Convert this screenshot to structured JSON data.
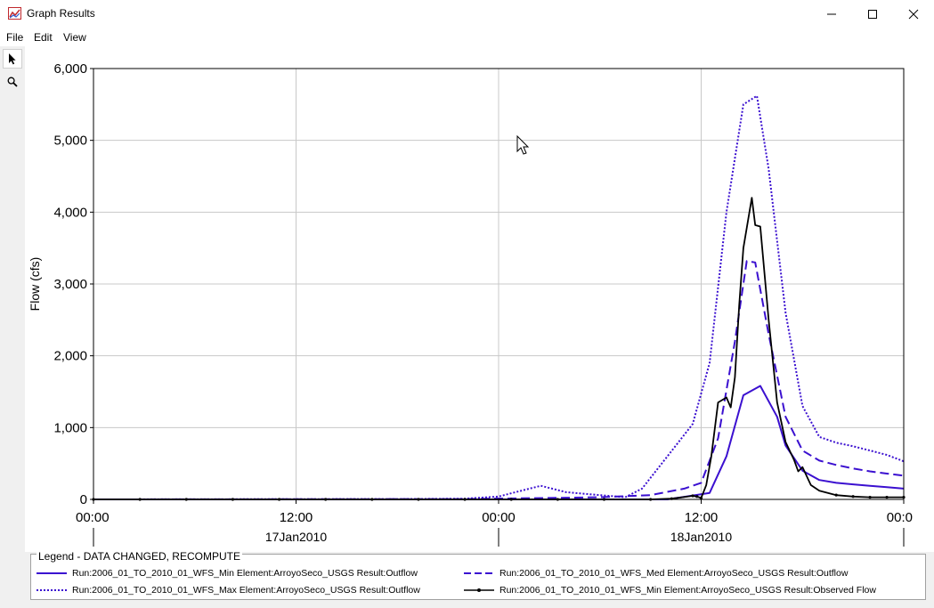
{
  "window": {
    "title": "Graph Results"
  },
  "menu": [
    "File",
    "Edit",
    "View"
  ],
  "icons": {
    "app": "graph-app-icon",
    "pointer": "pointer-arrow-icon",
    "zoom": "magnifier-icon",
    "cursor": "mouse-cursor-icon"
  },
  "legend": {
    "title": "Legend - DATA CHANGED, RECOMPUTE",
    "entries": [
      {
        "label": "Run:2006_01_TO_2010_01_WFS_Min Element:ArroyoSeco_USGS Result:Outflow",
        "color": "#3b10d0",
        "style": "solid"
      },
      {
        "label": "Run:2006_01_TO_2010_01_WFS_Med Element:ArroyoSeco_USGS Result:Outflow",
        "color": "#3b10d0",
        "style": "dashed"
      },
      {
        "label": "Run:2006_01_TO_2010_01_WFS_Max Element:ArroyoSeco_USGS Result:Outflow",
        "color": "#3b10d0",
        "style": "dotted"
      },
      {
        "label": "Run:2006_01_TO_2010_01_WFS_Min Element:ArroyoSeco_USGS Result:Observed Flow",
        "color": "#000000",
        "style": "solid-marker"
      }
    ]
  },
  "chart_data": {
    "type": "line",
    "ylabel": "Flow (cfs)",
    "ylim": [
      0,
      6000
    ],
    "yticks": [
      0,
      1000,
      2000,
      3000,
      4000,
      5000,
      6000
    ],
    "ytick_labels": [
      "0",
      "1,000",
      "2,000",
      "3,000",
      "4,000",
      "5,000",
      "6,000"
    ],
    "xlim_hours": [
      0,
      48
    ],
    "xticks_hours": [
      0,
      12,
      24,
      36,
      48
    ],
    "xtick_labels": [
      "00:00",
      "12:00",
      "00:00",
      "12:00",
      "00:0"
    ],
    "date_labels": [
      {
        "label": "17Jan2010",
        "at_hours": 12
      },
      {
        "label": "18Jan2010",
        "at_hours": 36
      }
    ],
    "day_separators_hours": [
      0,
      24,
      48
    ],
    "grid": true,
    "series": [
      {
        "name": "Run:2006_01_TO_2010_01_WFS_Min Element:ArroyoSeco_USGS Result:Outflow",
        "style": "solid",
        "color": "#3b10d0",
        "x": [
          0,
          24,
          34,
          36.5,
          37.5,
          38.5,
          39.5,
          40.5,
          41,
          42,
          43,
          44,
          45,
          46,
          47,
          48
        ],
        "y": [
          0,
          0,
          0,
          90,
          600,
          1450,
          1580,
          1150,
          750,
          400,
          270,
          230,
          210,
          190,
          170,
          150
        ]
      },
      {
        "name": "Run:2006_01_TO_2010_01_WFS_Med Element:ArroyoSeco_USGS Result:Outflow",
        "style": "dashed",
        "color": "#3b10d0",
        "x": [
          0,
          22,
          27,
          30,
          33,
          35,
          36,
          37,
          38,
          38.7,
          39.2,
          40,
          41,
          42,
          43,
          44,
          45,
          46,
          47,
          48
        ],
        "y": [
          0,
          5,
          20,
          30,
          60,
          150,
          230,
          850,
          2200,
          3320,
          3300,
          2300,
          1150,
          680,
          540,
          480,
          430,
          390,
          360,
          330
        ]
      },
      {
        "name": "Run:2006_01_TO_2010_01_WFS_Max Element:ArroyoSeco_USGS Result:Outflow",
        "style": "dotted",
        "color": "#3b10d0",
        "x": [
          0,
          18,
          22,
          24,
          25.5,
          26.5,
          28,
          30,
          31.5,
          32.5,
          34,
          35.5,
          36.5,
          37.5,
          38.5,
          39.3,
          40,
          41,
          42,
          43,
          44,
          45,
          46,
          47,
          48
        ],
        "y": [
          0,
          5,
          10,
          40,
          130,
          190,
          100,
          60,
          30,
          150,
          600,
          1050,
          1900,
          4000,
          5500,
          5620,
          4600,
          2600,
          1300,
          870,
          790,
          740,
          680,
          620,
          530
        ]
      },
      {
        "name": "Run:2006_01_TO_2010_01_WFS_Min Element:ArroyoSeco_USGS Result:Observed Flow",
        "style": "solid-marker",
        "color": "#000000",
        "x": [
          0,
          2.75,
          5.5,
          8.25,
          11,
          13.75,
          16.5,
          19.25,
          22,
          24.75,
          27.5,
          30.25,
          33,
          34.25,
          35.5,
          35.75,
          36,
          36.3,
          36.6,
          37,
          37.5,
          37.75,
          38,
          38.25,
          38.5,
          39,
          39.2,
          39.5,
          40,
          40.5,
          41,
          41.5,
          41.75,
          42,
          42.5,
          43,
          44,
          45,
          46,
          47,
          48
        ],
        "y": [
          0,
          0,
          0,
          0,
          0,
          0,
          0,
          0,
          0,
          0,
          0,
          0,
          0,
          10,
          50,
          40,
          20,
          200,
          600,
          1350,
          1420,
          1280,
          1700,
          2700,
          3500,
          4200,
          3820,
          3800,
          2500,
          1350,
          800,
          550,
          390,
          450,
          200,
          120,
          60,
          40,
          30,
          30,
          30
        ]
      }
    ]
  }
}
